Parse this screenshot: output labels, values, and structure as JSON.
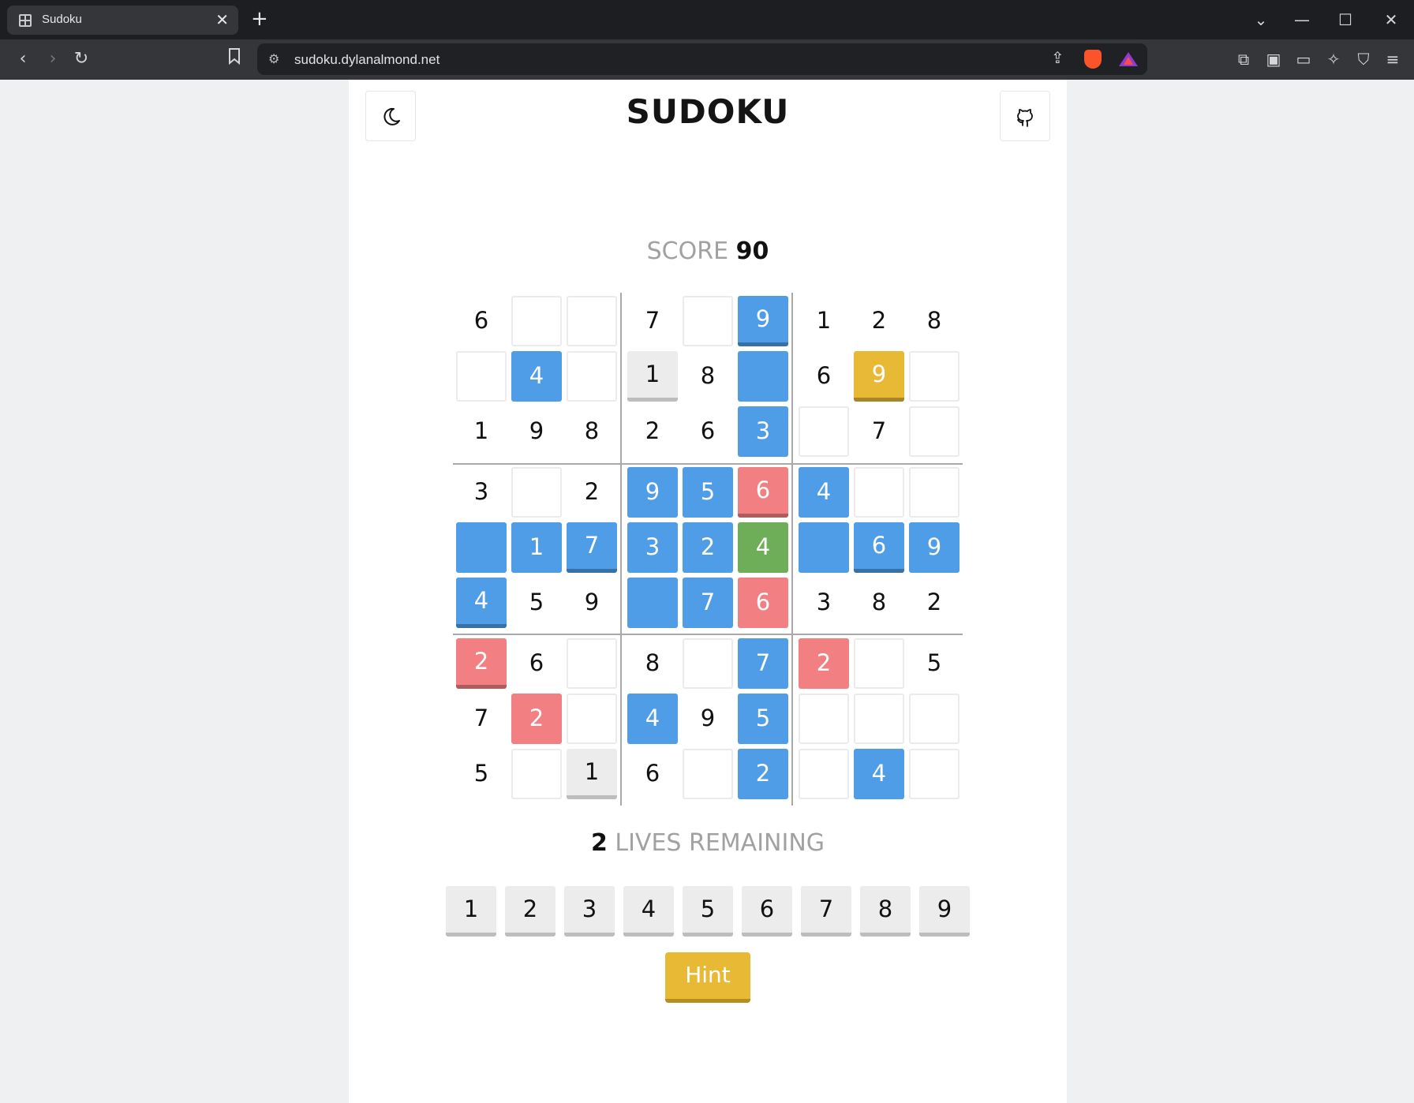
{
  "browser": {
    "tab_title": "Sudoku",
    "tab_close": "✕",
    "new_tab": "+",
    "url": "sudoku.dylanalmond.net",
    "icons": [
      "back-icon",
      "forward-icon",
      "reload-icon",
      "bookmark-icon",
      "site-settings-icon",
      "share-icon",
      "brave-shields-icon",
      "brave-rewards-icon",
      "extensions-icon",
      "sidebar-icon",
      "wallet-icon",
      "leo-ai-icon",
      "vpn-icon",
      "menu-icon"
    ]
  },
  "page": {
    "title": "SUDOKU",
    "score_label": "SCORE",
    "score_value": "90",
    "lives_value": "2",
    "lives_label": "LIVES REMAINING",
    "hint_label": "Hint",
    "numpad": [
      "1",
      "2",
      "3",
      "4",
      "5",
      "6",
      "7",
      "8",
      "9"
    ]
  },
  "board": [
    [
      {
        "v": "6",
        "s": "given"
      },
      {
        "v": "",
        "s": "empty"
      },
      {
        "v": "",
        "s": "empty"
      },
      {
        "v": "7",
        "s": "given"
      },
      {
        "v": "",
        "s": "empty"
      },
      {
        "v": "9",
        "s": "blue-raised"
      },
      {
        "v": "1",
        "s": "given"
      },
      {
        "v": "2",
        "s": "given"
      },
      {
        "v": "8",
        "s": "given"
      }
    ],
    [
      {
        "v": "",
        "s": "empty"
      },
      {
        "v": "4",
        "s": "blue"
      },
      {
        "v": "",
        "s": "empty"
      },
      {
        "v": "1",
        "s": "grey-raised"
      },
      {
        "v": "8",
        "s": "given"
      },
      {
        "v": "",
        "s": "blue"
      },
      {
        "v": "6",
        "s": "given"
      },
      {
        "v": "9",
        "s": "yellow-raised"
      },
      {
        "v": "",
        "s": "empty"
      }
    ],
    [
      {
        "v": "1",
        "s": "given"
      },
      {
        "v": "9",
        "s": "given"
      },
      {
        "v": "8",
        "s": "given"
      },
      {
        "v": "2",
        "s": "given"
      },
      {
        "v": "6",
        "s": "given"
      },
      {
        "v": "3",
        "s": "blue"
      },
      {
        "v": "",
        "s": "empty"
      },
      {
        "v": "7",
        "s": "given"
      },
      {
        "v": "",
        "s": "empty"
      }
    ],
    [
      {
        "v": "3",
        "s": "given"
      },
      {
        "v": "",
        "s": "empty"
      },
      {
        "v": "2",
        "s": "given"
      },
      {
        "v": "9",
        "s": "blue"
      },
      {
        "v": "5",
        "s": "blue"
      },
      {
        "v": "6",
        "s": "red-raised"
      },
      {
        "v": "4",
        "s": "blue"
      },
      {
        "v": "",
        "s": "empty"
      },
      {
        "v": "",
        "s": "empty"
      }
    ],
    [
      {
        "v": "",
        "s": "blue"
      },
      {
        "v": "1",
        "s": "blue"
      },
      {
        "v": "7",
        "s": "blue-raised"
      },
      {
        "v": "3",
        "s": "blue"
      },
      {
        "v": "2",
        "s": "blue"
      },
      {
        "v": "4",
        "s": "green"
      },
      {
        "v": "",
        "s": "blue"
      },
      {
        "v": "6",
        "s": "blue-raised"
      },
      {
        "v": "9",
        "s": "blue"
      }
    ],
    [
      {
        "v": "4",
        "s": "blue-raised"
      },
      {
        "v": "5",
        "s": "given"
      },
      {
        "v": "9",
        "s": "given"
      },
      {
        "v": "",
        "s": "blue"
      },
      {
        "v": "7",
        "s": "blue"
      },
      {
        "v": "6",
        "s": "red"
      },
      {
        "v": "3",
        "s": "given"
      },
      {
        "v": "8",
        "s": "given"
      },
      {
        "v": "2",
        "s": "given"
      }
    ],
    [
      {
        "v": "2",
        "s": "red-raised"
      },
      {
        "v": "6",
        "s": "given"
      },
      {
        "v": "",
        "s": "empty"
      },
      {
        "v": "8",
        "s": "given"
      },
      {
        "v": "",
        "s": "empty"
      },
      {
        "v": "7",
        "s": "blue"
      },
      {
        "v": "2",
        "s": "red"
      },
      {
        "v": "",
        "s": "empty"
      },
      {
        "v": "5",
        "s": "given"
      }
    ],
    [
      {
        "v": "7",
        "s": "given"
      },
      {
        "v": "2",
        "s": "red"
      },
      {
        "v": "",
        "s": "empty"
      },
      {
        "v": "4",
        "s": "blue"
      },
      {
        "v": "9",
        "s": "given"
      },
      {
        "v": "5",
        "s": "blue"
      },
      {
        "v": "",
        "s": "empty"
      },
      {
        "v": "",
        "s": "empty"
      },
      {
        "v": "",
        "s": "empty"
      }
    ],
    [
      {
        "v": "5",
        "s": "given"
      },
      {
        "v": "",
        "s": "empty"
      },
      {
        "v": "1",
        "s": "grey-raised"
      },
      {
        "v": "6",
        "s": "given"
      },
      {
        "v": "",
        "s": "empty"
      },
      {
        "v": "2",
        "s": "blue"
      },
      {
        "v": "",
        "s": "empty"
      },
      {
        "v": "4",
        "s": "blue"
      },
      {
        "v": "",
        "s": "empty"
      }
    ]
  ],
  "colors": {
    "highlight_blue": "#4f9de6",
    "error_red": "#f28083",
    "selected_green": "#6eae58",
    "hint_yellow": "#e8b935"
  }
}
